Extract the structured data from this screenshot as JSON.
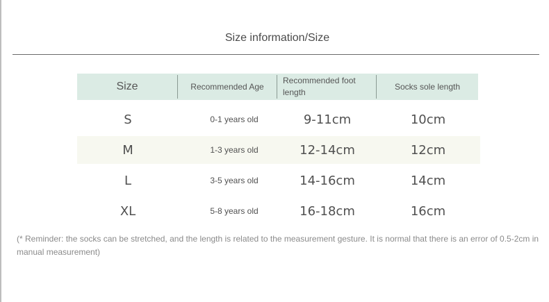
{
  "title": "Size information/Size",
  "table": {
    "headers": {
      "size": "Size",
      "age": "Recommended Age",
      "foot": "Recommended foot length",
      "sole": "Socks sole length"
    },
    "rows": [
      {
        "size": "S",
        "age": "0-1 years old",
        "foot": "9-11cm",
        "sole": "10cm"
      },
      {
        "size": "M",
        "age": "1-3 years old",
        "foot": "12-14cm",
        "sole": "12cm"
      },
      {
        "size": "L",
        "age": "3-5 years old",
        "foot": "14-16cm",
        "sole": "14cm"
      },
      {
        "size": "XL",
        "age": "5-8 years old",
        "foot": "16-18cm",
        "sole": "16cm"
      }
    ]
  },
  "note": "(* Reminder: the socks can be stretched, and the length is related to the measurement gesture. It is normal that there is an error of 0.5-2cm in manual measurement)",
  "colors": {
    "header_bg": "#dbebe4",
    "shaded_row_bg": "#f7f8f0"
  }
}
